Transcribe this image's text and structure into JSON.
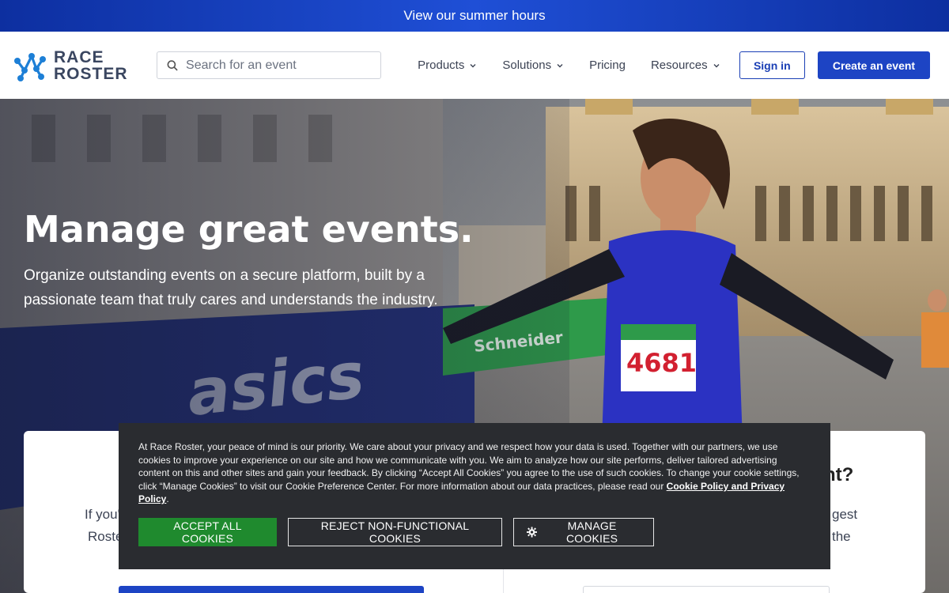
{
  "topbar": {
    "link_text": "View our summer hours"
  },
  "logo": {
    "line1": "RACE",
    "line2": "ROSTER"
  },
  "search": {
    "placeholder": "Search for an event"
  },
  "nav": {
    "products": "Products",
    "solutions": "Solutions",
    "pricing": "Pricing",
    "resources": "Resources"
  },
  "header_buttons": {
    "sign_in": "Sign in",
    "create_event": "Create an event"
  },
  "hero": {
    "title": "Manage great events.",
    "subtitle": "Organize outstanding events on a secure platform, built by a passionate team that truly cares and understands the industry.",
    "bib_number": "4681",
    "banner_brand": "asics",
    "sponsor": "Schneider Electric"
  },
  "card": {
    "left_text_line1": "If you'",
    "left_text_line2": "Roste",
    "right_title_fragment": "nt?",
    "right_text_line1": "gest",
    "right_text_line2": "the"
  },
  "cookie": {
    "text": "At Race Roster, your peace of mind is our priority. We care about your privacy and we respect how your data is used. Together with our partners, we use cookies to improve your experience on our site and how we communicate with you. We aim to analyze how our site performs, deliver tailored advertising content on this and other sites and gain your feedback. By clicking “Accept All Cookies” you agree to the use of such cookies. To change your cookie settings, click “Manage Cookies” to visit our Cookie Preference Center. For more information about our data practices, please read our ",
    "policy_link": "Cookie Policy and Privacy Policy",
    "text_end": ".",
    "accept": "ACCEPT ALL COOKIES",
    "reject": "REJECT NON-FUNCTIONAL COOKIES",
    "manage": "MANAGE COOKIES"
  },
  "colors": {
    "brand_blue": "#1d44c4",
    "topbar_blue": "#1f4fd6",
    "accept_green": "#1f8a2e",
    "cookie_bg": "#2a2c30"
  }
}
